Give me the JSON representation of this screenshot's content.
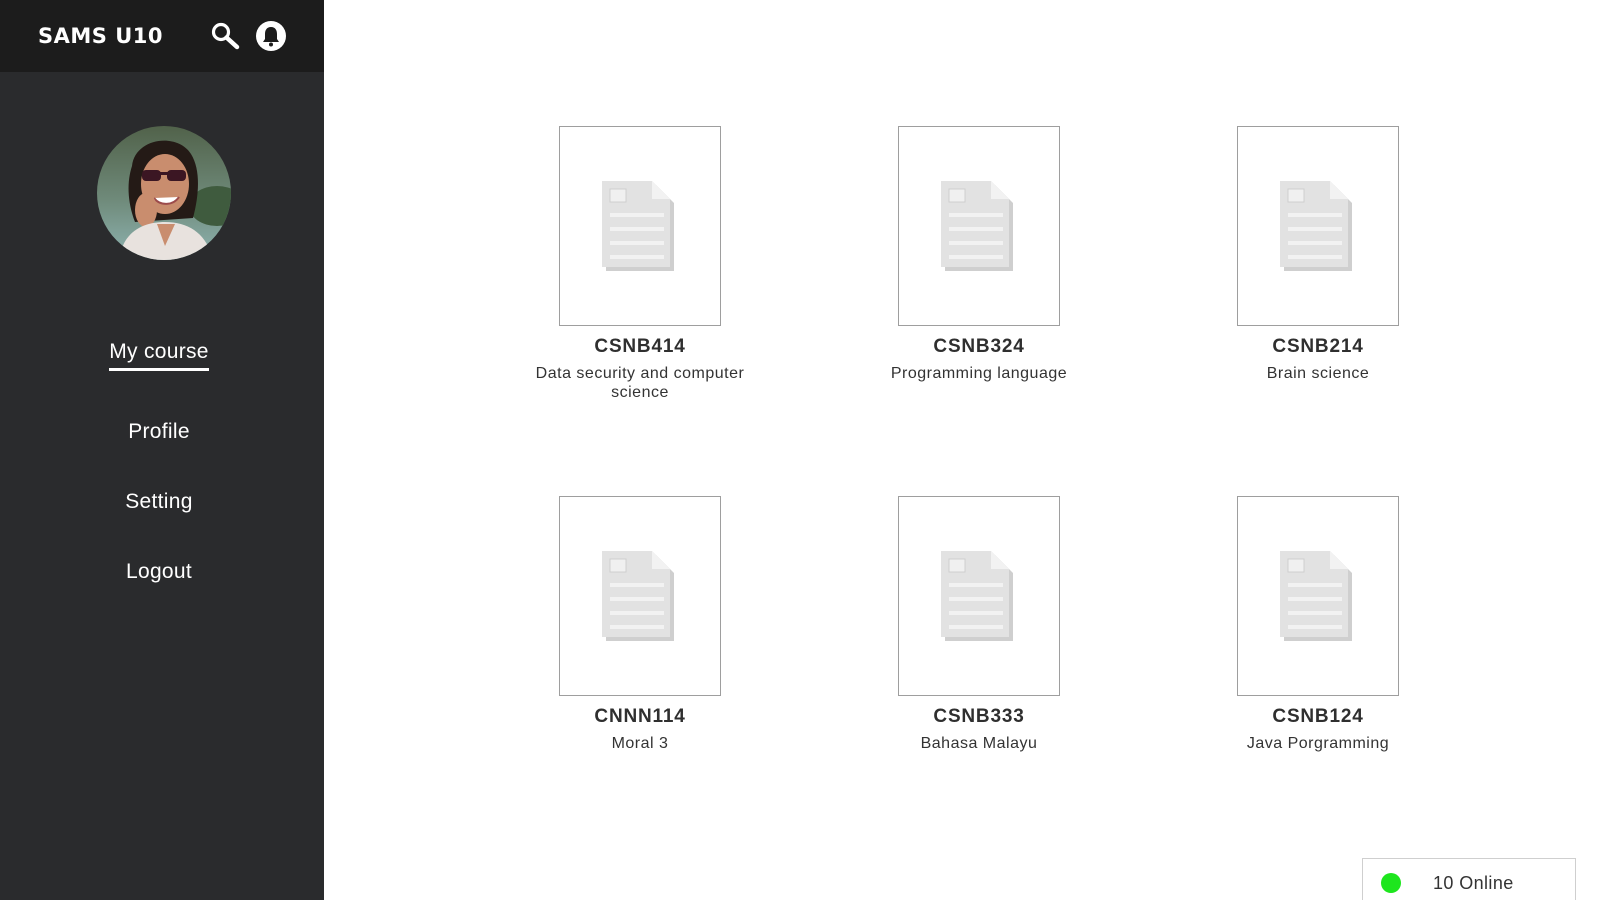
{
  "app": {
    "brand": "SAMS U10"
  },
  "sidebar": {
    "nav": [
      {
        "label": "My course",
        "active": true
      },
      {
        "label": "Profile",
        "active": false
      },
      {
        "label": "Setting",
        "active": false
      },
      {
        "label": "Logout",
        "active": false
      }
    ]
  },
  "courses": [
    {
      "code": "CSNB414",
      "title": "Data security and computer science"
    },
    {
      "code": "CSNB324",
      "title": "Programming language"
    },
    {
      "code": "CSNB214",
      "title": "Brain science"
    },
    {
      "code": "CNNN114",
      "title": "Moral 3"
    },
    {
      "code": "CSNB333",
      "title": "Bahasa Malayu"
    },
    {
      "code": "CSNB124",
      "title": "Java Porgramming"
    }
  ],
  "status": {
    "online_label": "10 Online",
    "online_color": "#1ee61e"
  },
  "colors": {
    "sidebar": "#2a2b2d",
    "topbar": "#1c1c1c"
  },
  "icons": {
    "search": "search-icon",
    "notifications": "bell-icon",
    "course_thumbnail": "document-placeholder-icon"
  }
}
